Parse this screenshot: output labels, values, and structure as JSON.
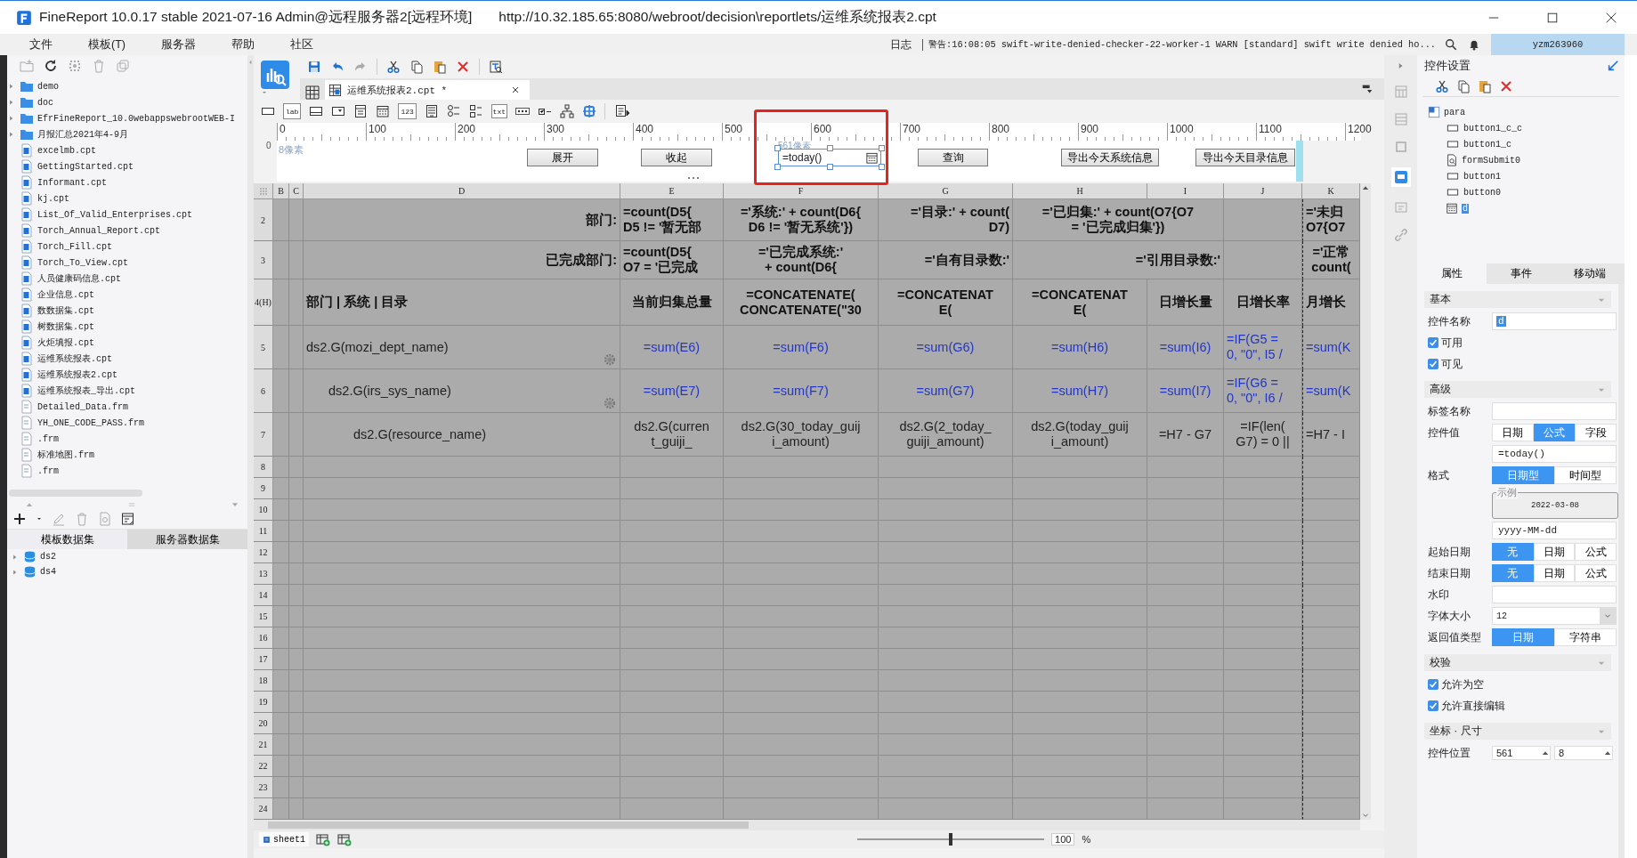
{
  "window": {
    "title": "FineReport 10.0.17 stable 2021-07-16 Admin@远程服务器2[远程环境]",
    "url": "http://10.32.185.65:8080/webroot/decision\\reportlets/运维系统报表2.cpt"
  },
  "menu": [
    "文件",
    "模板(T)",
    "服务器",
    "帮助",
    "社区"
  ],
  "status": {
    "log_label": "日志",
    "warning": "警告:16:08:05 swift-write-denied-checker-22-worker-1 WARN [standard] swift write denied ho...",
    "user": "yzm263960"
  },
  "file_panel": {
    "items": [
      {
        "kind": "folder",
        "name": "demo",
        "expanded": false
      },
      {
        "kind": "folder",
        "name": "doc",
        "expanded": false
      },
      {
        "kind": "folder",
        "name": "EfrFineReport_10.0webappswebrootWEB-I",
        "expanded": false
      },
      {
        "kind": "folder",
        "name": "月报汇总2021年4-9月",
        "expanded": false
      },
      {
        "kind": "cpt",
        "name": "excelmb.cpt"
      },
      {
        "kind": "cpt",
        "name": "GettingStarted.cpt"
      },
      {
        "kind": "cpt",
        "name": "Informant.cpt"
      },
      {
        "kind": "cpt",
        "name": "kj.cpt"
      },
      {
        "kind": "cpt",
        "name": "List_Of_Valid_Enterprises.cpt"
      },
      {
        "kind": "cpt",
        "name": "Torch_Annual_Report.cpt"
      },
      {
        "kind": "cpt",
        "name": "Torch_Fill.cpt"
      },
      {
        "kind": "cpt",
        "name": "Torch_To_View.cpt"
      },
      {
        "kind": "cpt",
        "name": "人员健康码信息.cpt"
      },
      {
        "kind": "cpt",
        "name": "企业信息.cpt"
      },
      {
        "kind": "cpt",
        "name": "数数据集.cpt"
      },
      {
        "kind": "cpt",
        "name": "树数据集.cpt"
      },
      {
        "kind": "cpt",
        "name": "火炬填报.cpt"
      },
      {
        "kind": "cpt",
        "name": "运维系统报表.cpt"
      },
      {
        "kind": "cpt",
        "name": "运维系统报表2.cpt"
      },
      {
        "kind": "cpt",
        "name": "运维系统报表_导出.cpt"
      },
      {
        "kind": "frm",
        "name": "Detailed_Data.frm"
      },
      {
        "kind": "frm",
        "name": "YH_ONE_CODE_PASS.frm"
      },
      {
        "kind": "frm",
        "name": ".frm"
      },
      {
        "kind": "frm",
        "name": "标准地图.frm"
      },
      {
        "kind": "frm",
        "name": ".frm"
      }
    ],
    "dataset_tabs": [
      {
        "label": "模板数据集",
        "selected": true
      },
      {
        "label": "服务器数据集",
        "selected": false
      }
    ],
    "datasets": [
      {
        "name": "ds2",
        "expanded": false
      },
      {
        "name": "ds4",
        "expanded": false
      }
    ]
  },
  "editor": {
    "tabs": [
      {
        "label": "运维系统报表2.cpt *",
        "selected": true
      }
    ]
  },
  "widget_tools": [
    {
      "kind": "textbox"
    },
    {
      "kind": "label",
      "text": "lab"
    },
    {
      "kind": "button"
    },
    {
      "kind": "combo"
    },
    {
      "kind": "param"
    },
    {
      "kind": "date"
    },
    {
      "kind": "number",
      "text": "123"
    },
    {
      "kind": "textarea"
    },
    {
      "kind": "radio"
    },
    {
      "kind": "checkgroup"
    },
    {
      "kind": "text",
      "text": "txt"
    },
    {
      "kind": "password"
    },
    {
      "kind": "checkbox"
    },
    {
      "kind": "tree"
    },
    {
      "kind": "target"
    },
    {
      "kind": "form"
    }
  ],
  "ruler": {
    "labels": [
      "0",
      "100",
      "200",
      "300",
      "400",
      "500",
      "600",
      "700",
      "800",
      "900",
      "1000",
      "1100",
      "1200"
    ],
    "vertical_label": "0"
  },
  "parameter_panel": {
    "margin_label": "8像素",
    "widgets": [
      {
        "kind": "button",
        "label": "展开",
        "selected": false
      },
      {
        "kind": "button",
        "label": "收起",
        "selected": false
      },
      {
        "kind": "date",
        "value": "=today()",
        "position_label": "561像素",
        "selected": true
      },
      {
        "kind": "button",
        "label": "查询",
        "selected": false
      },
      {
        "kind": "button",
        "label": "导出今天系统信息",
        "selected": false
      },
      {
        "kind": "button",
        "label": "导出今天目录信息",
        "selected": false
      }
    ]
  },
  "grid": {
    "columns": [
      "B",
      "C",
      "D",
      "E",
      "F",
      "G",
      "H",
      "I",
      "J",
      "K"
    ],
    "rows": [
      {
        "header": "2",
        "cells": [
          {
            "kind": "empty"
          },
          {
            "kind": "empty"
          },
          {
            "kind": "bold-right",
            "text": "部门:"
          },
          {
            "kind": "bold-left",
            "text": "=count(D5{\nD5 != '暂无部"
          },
          {
            "kind": "bold-center",
            "text": "='系统:' + count(D6{\nD6 != '暂无系统'})"
          },
          {
            "kind": "bold-right",
            "text": "='目录:' + count(\nD7)"
          },
          {
            "kind": "bold-center",
            "merged": true,
            "text": "='已归集:' + count(O7{O7\n= '已完成归集'})"
          },
          {
            "kind": "empty"
          },
          {
            "kind": "bold-left",
            "text": "='未归\nO7{O7"
          }
        ]
      },
      {
        "header": "3",
        "cells": [
          {
            "kind": "empty"
          },
          {
            "kind": "empty"
          },
          {
            "kind": "bold-right",
            "text": "已完成部门:"
          },
          {
            "kind": "bold-left",
            "text": "=count(D5{\nO7 = '已完成"
          },
          {
            "kind": "bold-center",
            "text": "='已完成系统:'\n+ count(D6{"
          },
          {
            "kind": "bold-right",
            "text": "='自有目录数:'"
          },
          {
            "kind": "bold-right",
            "merged": true,
            "text": "='引用目录数:'"
          },
          {
            "kind": "empty"
          },
          {
            "kind": "bold-center",
            "text": "='正常\ncount("
          }
        ]
      },
      {
        "header": "4(H)",
        "cells": [
          {
            "kind": "empty"
          },
          {
            "kind": "empty"
          },
          {
            "kind": "bold-left",
            "text": "部门 | 系统 | 目录"
          },
          {
            "kind": "bold-center",
            "text": "当前归集总量"
          },
          {
            "kind": "bold-center",
            "text": "=CONCATENATE(\nCONCATENATE(\"30"
          },
          {
            "kind": "bold-center",
            "text": "=CONCATENAT\nE("
          },
          {
            "kind": "bold-center",
            "text": "=CONCATENAT\nE("
          },
          {
            "kind": "bold-center",
            "text": "日增长量"
          },
          {
            "kind": "bold-center",
            "text": "日增长率"
          },
          {
            "kind": "bold-left",
            "text": "月增长"
          }
        ]
      },
      {
        "header": "5",
        "cells": [
          {
            "kind": "empty"
          },
          {
            "kind": "empty"
          },
          {
            "kind": "text-left",
            "text": "ds2.G(mozi_dept_name)",
            "gear": true
          },
          {
            "kind": "blue-center",
            "text": "=sum(E6)"
          },
          {
            "kind": "blue-center",
            "text": "=sum(F6)"
          },
          {
            "kind": "blue-center",
            "text": "=sum(G6)"
          },
          {
            "kind": "blue-center",
            "text": "=sum(H6)"
          },
          {
            "kind": "blue-center",
            "text": "=sum(I6)"
          },
          {
            "kind": "blue-left",
            "text": "=IF(G5 =\n0, \"0\", I5 /"
          },
          {
            "kind": "blue-left",
            "text": "=sum(K"
          }
        ]
      },
      {
        "header": "6",
        "cells": [
          {
            "kind": "empty"
          },
          {
            "kind": "empty"
          },
          {
            "kind": "text-indent",
            "text": "ds2.G(irs_sys_name)",
            "gear": true
          },
          {
            "kind": "blue-center",
            "text": "=sum(E7)"
          },
          {
            "kind": "blue-center",
            "text": "=sum(F7)"
          },
          {
            "kind": "blue-center",
            "text": "=sum(G7)"
          },
          {
            "kind": "blue-center",
            "text": "=sum(H7)"
          },
          {
            "kind": "blue-center",
            "text": "=sum(I7)"
          },
          {
            "kind": "blue-left",
            "text": "=IF(G6 =\n0, \"0\", I6 /"
          },
          {
            "kind": "blue-left",
            "text": "=sum(K"
          }
        ]
      },
      {
        "header": "7",
        "cells": [
          {
            "kind": "empty"
          },
          {
            "kind": "empty"
          },
          {
            "kind": "text-indent-2",
            "text": "ds2.G(resource_name)"
          },
          {
            "kind": "text-center",
            "text": "ds2.G(curren\nt_guiji_"
          },
          {
            "kind": "text-center",
            "text": "ds2.G(30_today_guij\ni_amount)"
          },
          {
            "kind": "text-center",
            "text": "ds2.G(2_today_\nguiji_amount)"
          },
          {
            "kind": "text-center",
            "text": "ds2.G(today_guij\ni_amount)"
          },
          {
            "kind": "text-center",
            "text": "=H7 - G7"
          },
          {
            "kind": "text-center",
            "text": "=IF(len(\nG7) = 0 ||"
          },
          {
            "kind": "text-left",
            "text": "=H7 - I"
          }
        ]
      },
      {
        "header": "8"
      },
      {
        "header": "9"
      },
      {
        "header": "10"
      },
      {
        "header": "11"
      },
      {
        "header": "12"
      },
      {
        "header": "13"
      },
      {
        "header": "14"
      },
      {
        "header": "15"
      },
      {
        "header": "16"
      },
      {
        "header": "17"
      },
      {
        "header": "18"
      },
      {
        "header": "19"
      },
      {
        "header": "20"
      },
      {
        "header": "21"
      },
      {
        "header": "22"
      },
      {
        "header": "23"
      },
      {
        "header": "24"
      }
    ]
  },
  "sheet_bar": {
    "sheets": [
      {
        "label": "sheet1",
        "selected": true
      }
    ],
    "zoom": {
      "level": 0.5,
      "value": "100",
      "unit": "%"
    }
  },
  "properties": {
    "title": "控件设置",
    "tree": [
      {
        "name": "para",
        "kind": "container",
        "selected": false,
        "children": [
          {
            "name": "button1_c_c",
            "kind": "button",
            "selected": false
          },
          {
            "name": "button1_c",
            "kind": "button",
            "selected": false
          },
          {
            "name": "formSubmit0",
            "kind": "submit",
            "selected": false
          },
          {
            "name": "button1",
            "kind": "button",
            "selected": false
          },
          {
            "name": "button0",
            "kind": "button",
            "selected": false
          },
          {
            "name": "d",
            "kind": "date",
            "selected": true
          }
        ]
      }
    ],
    "tabs": [
      {
        "label": "属性",
        "selected": true
      },
      {
        "label": "事件",
        "selected": false
      },
      {
        "label": "移动端",
        "selected": false
      }
    ],
    "sections": [
      {
        "title": "基本",
        "expanded": true,
        "rows": [
          {
            "kind": "input",
            "label": "控件名称",
            "value": "d",
            "highlighted": true
          },
          {
            "kind": "checkbox",
            "label": "可用",
            "checked": true
          },
          {
            "kind": "checkbox",
            "label": "可见",
            "checked": true
          }
        ]
      },
      {
        "title": "高级",
        "expanded": true,
        "rows": [
          {
            "kind": "input",
            "label": "标签名称"
          },
          {
            "kind": "segmented",
            "label": "控件值",
            "options": [
              {
                "label": "日期",
                "selected": false
              },
              {
                "label": "公式",
                "selected": true
              },
              {
                "label": "字段",
                "selected": false
              }
            ]
          },
          {
            "kind": "input",
            "value": "=today()",
            "highlighted": false
          },
          {
            "kind": "segmented",
            "label": "格式",
            "options": [
              {
                "label": "日期型",
                "selected": true
              },
              {
                "label": "时间型",
                "selected": false
              }
            ]
          },
          {
            "kind": "sample",
            "legend": "示例",
            "value": "2022-03-08"
          },
          {
            "kind": "input",
            "value": "yyyy-MM-dd",
            "highlighted": false
          },
          {
            "kind": "segmented",
            "label": "起始日期",
            "options": [
              {
                "label": "无",
                "selected": true
              },
              {
                "label": "日期",
                "selected": false
              },
              {
                "label": "公式",
                "selected": false
              }
            ]
          },
          {
            "kind": "segmented",
            "label": "结束日期",
            "options": [
              {
                "label": "无",
                "selected": true
              },
              {
                "label": "日期",
                "selected": false
              },
              {
                "label": "公式",
                "selected": false
              }
            ]
          },
          {
            "kind": "input",
            "label": "水印"
          },
          {
            "kind": "select",
            "label": "字体大小",
            "value": "12"
          },
          {
            "kind": "segmented",
            "label": "返回值类型",
            "options": [
              {
                "label": "日期",
                "selected": true
              },
              {
                "label": "字符串",
                "selected": false
              }
            ]
          }
        ]
      },
      {
        "title": "校验",
        "expanded": true,
        "rows": [
          {
            "kind": "checkbox",
            "label": "允许为空",
            "checked": true
          },
          {
            "kind": "checkbox",
            "label": "允许直接编辑",
            "checked": true
          }
        ]
      },
      {
        "title": "坐标 · 尺寸",
        "expanded": true,
        "rows": [
          {
            "kind": "position",
            "label": "控件位置",
            "values": [
              "561",
              "8"
            ]
          }
        ]
      }
    ]
  }
}
